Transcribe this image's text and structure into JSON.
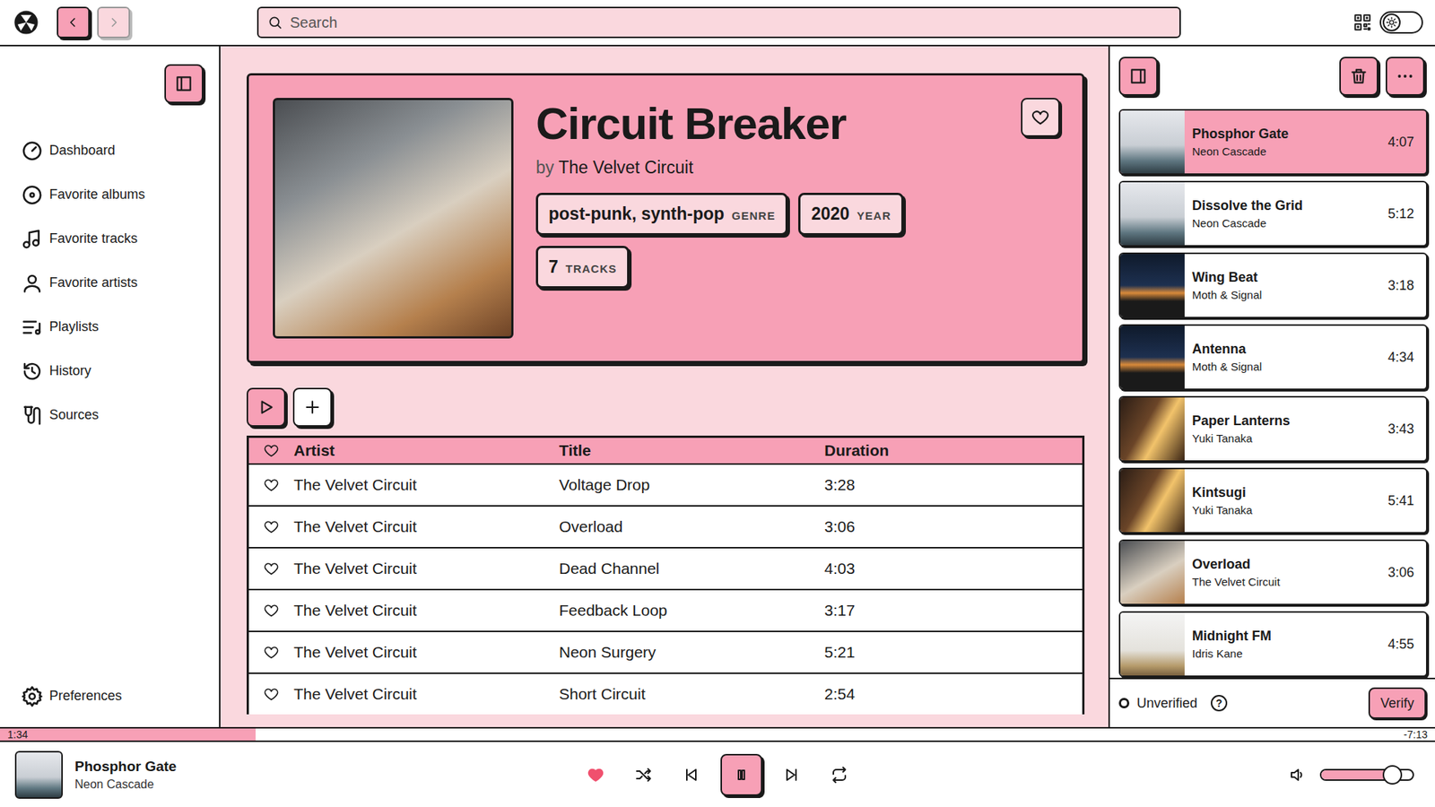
{
  "topbar": {
    "back": {
      "disabled": false
    },
    "forward": {
      "disabled": true
    },
    "search": {
      "placeholder": "Search"
    },
    "theme_toggle": {
      "on": false
    }
  },
  "sidebar": {
    "items": [
      {
        "label": "Dashboard",
        "selected": false
      },
      {
        "label": "Favorite albums",
        "selected": false
      },
      {
        "label": "Favorite tracks",
        "selected": false
      },
      {
        "label": "Favorite artists",
        "selected": false
      },
      {
        "label": "Playlists",
        "selected": false
      },
      {
        "label": "History",
        "selected": false
      },
      {
        "label": "Sources",
        "selected": false
      }
    ],
    "footer": {
      "label": "Preferences",
      "selected": false
    }
  },
  "album": {
    "title": "Circuit Breaker",
    "by": "by",
    "artist": "The Velvet Circuit",
    "favorite": false,
    "chips": [
      {
        "value": "post-punk, synth-pop",
        "label": "GENRE"
      },
      {
        "value": "2020",
        "label": "YEAR"
      },
      {
        "value": "7",
        "label": "TRACKS"
      }
    ]
  },
  "tracks": {
    "columns": [
      "Artist",
      "Title",
      "Duration"
    ],
    "rows": [
      {
        "artist": "The Velvet Circuit",
        "title": "Voltage Drop",
        "duration": "3:28",
        "favorite": false
      },
      {
        "artist": "The Velvet Circuit",
        "title": "Overload",
        "duration": "3:06",
        "favorite": false
      },
      {
        "artist": "The Velvet Circuit",
        "title": "Dead Channel",
        "duration": "4:03",
        "favorite": false
      },
      {
        "artist": "The Velvet Circuit",
        "title": "Feedback Loop",
        "duration": "3:17",
        "favorite": false
      },
      {
        "artist": "The Velvet Circuit",
        "title": "Neon Surgery",
        "duration": "5:21",
        "favorite": false
      },
      {
        "artist": "The Velvet Circuit",
        "title": "Short Circuit",
        "duration": "2:54",
        "favorite": false
      }
    ]
  },
  "queue": {
    "items": [
      {
        "title": "Phosphor Gate",
        "artist": "Neon Cascade",
        "duration": "4:07",
        "selected": true
      },
      {
        "title": "Dissolve the Grid",
        "artist": "Neon Cascade",
        "duration": "5:12",
        "selected": false
      },
      {
        "title": "Wing Beat",
        "artist": "Moth & Signal",
        "duration": "3:18",
        "selected": false
      },
      {
        "title": "Antenna",
        "artist": "Moth & Signal",
        "duration": "4:34",
        "selected": false
      },
      {
        "title": "Paper Lanterns",
        "artist": "Yuki Tanaka",
        "duration": "3:43",
        "selected": false
      },
      {
        "title": "Kintsugi",
        "artist": "Yuki Tanaka",
        "duration": "5:41",
        "selected": false
      },
      {
        "title": "Overload",
        "artist": "The Velvet Circuit",
        "duration": "3:06",
        "selected": false
      },
      {
        "title": "Midnight FM",
        "artist": "Idris Kane",
        "duration": "4:55",
        "selected": false
      }
    ]
  },
  "verification": {
    "status": "Unverified",
    "verified": false,
    "help": "?",
    "button": "Verify"
  },
  "progress": {
    "elapsed": "1:34",
    "remaining": "-7:13",
    "level": 0.178
  },
  "player": {
    "title": "Phosphor Gate",
    "artist": "Neon Cascade",
    "liked": true,
    "playing": true,
    "shuffle": false,
    "repeat": false,
    "volume": {
      "level": 0.78
    }
  }
}
